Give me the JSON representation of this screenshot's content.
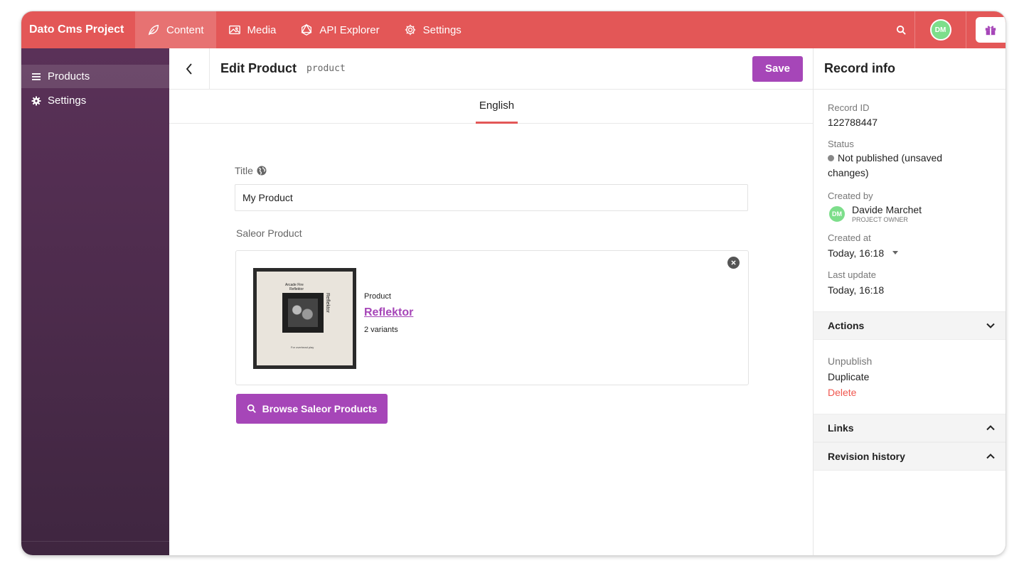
{
  "app": {
    "project_name": "Dato Cms Project",
    "nav_tabs": [
      {
        "label": "Content",
        "icon": "leaf-icon",
        "active": true
      },
      {
        "label": "Media",
        "icon": "image-icon",
        "active": false
      },
      {
        "label": "API Explorer",
        "icon": "graph-icon",
        "active": false
      },
      {
        "label": "Settings",
        "icon": "gear-icon",
        "active": false
      }
    ],
    "user_initials": "DM",
    "colors": {
      "topbar": "#e35757",
      "accent": "#a646b8",
      "sidebar": "#4a2b4a",
      "avatar": "#7dde8b",
      "danger": "#e35757"
    }
  },
  "sidebar": {
    "items": [
      {
        "label": "Products",
        "icon": "list-icon",
        "active": true
      },
      {
        "label": "Settings",
        "icon": "cog-icon",
        "active": false
      }
    ]
  },
  "editor": {
    "title": "Edit Product",
    "api_key": "product",
    "save_label": "Save",
    "locale": "English",
    "fields": {
      "title_label": "Title",
      "title_value": "My Product",
      "saleor_label": "Saleor Product"
    },
    "product": {
      "kind": "Product",
      "name": "Reflektor",
      "variants": "2 variants",
      "cover_text_artist": "Arcade Fire",
      "cover_text_title": "Reflektor",
      "cover_text_footer": "For overhead play",
      "cover_spine": "Reflektor"
    },
    "browse_label": "Browse Saleor Products"
  },
  "record_info": {
    "heading": "Record info",
    "record_id_label": "Record ID",
    "record_id": "122788447",
    "status_label": "Status",
    "status": "Not published (unsaved changes)",
    "created_by_label": "Created by",
    "creator_initials": "DM",
    "creator_name": "Davide Marchet",
    "creator_role": "PROJECT OWNER",
    "created_at_label": "Created at",
    "created_at": "Today, 16:18",
    "last_update_label": "Last update",
    "last_update": "Today, 16:18",
    "actions_label": "Actions",
    "actions": {
      "unpublish": "Unpublish",
      "duplicate": "Duplicate",
      "delete": "Delete"
    },
    "links_label": "Links",
    "revision_label": "Revision history"
  }
}
